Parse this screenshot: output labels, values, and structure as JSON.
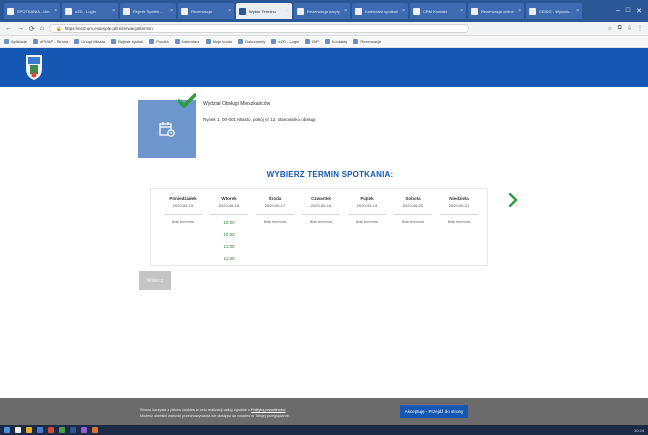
{
  "browser": {
    "tabs": [
      {
        "label": "SPOTKANIA - Um...",
        "active": false
      },
      {
        "label": "eZD - Login",
        "active": false
      },
      {
        "label": "Rejestr Spółek ...",
        "active": false
      },
      {
        "label": "Rezerwacja",
        "active": false
      },
      {
        "label": "Wybór Terminu",
        "active": true
      },
      {
        "label": "Rezerwacja wizyty",
        "active": false
      },
      {
        "label": "Kalendarz spotkań",
        "active": false
      },
      {
        "label": "CRM Kontakt",
        "active": false
      },
      {
        "label": "Rezerwacja online",
        "active": false
      },
      {
        "label": "CEIDG - Wyszuk...",
        "active": false
      }
    ],
    "url": "https://ezd.um.example.pl/rezerwacja/termin",
    "bookmarks": [
      "Aplikacje",
      "ePUAP - Strona",
      "Urząd Miasta",
      "Rejestr spółek",
      "Poczta",
      "Kalendarz",
      "Moje konto",
      "Dokumenty",
      "eZD - Login",
      "BIP",
      "Kontakty",
      "Rezerwacje"
    ]
  },
  "office": {
    "name": "Wydział Obsługi Mieszkańców",
    "address": "Rynek 1, 00-001 Miasto, pokój nr 12, stanowisko obsługi"
  },
  "heading": "WYBIERZ TERMIN SPOTKANIA:",
  "calendar": {
    "days": [
      {
        "name": "Poniedziałek",
        "date": "2020-06-15",
        "status": "Brak terminów",
        "slots": []
      },
      {
        "name": "Wtorek",
        "date": "2020-06-16",
        "status": "",
        "slots": [
          "10:00",
          "10:30",
          "11:00",
          "11:30"
        ]
      },
      {
        "name": "Środa",
        "date": "2020-06-17",
        "status": "Brak terminów",
        "slots": []
      },
      {
        "name": "Czwartek",
        "date": "2020-06-18",
        "status": "Brak terminów",
        "slots": []
      },
      {
        "name": "Piątek",
        "date": "2020-06-19",
        "status": "Brak terminów",
        "slots": []
      },
      {
        "name": "Sobota",
        "date": "2020-06-20",
        "status": "Brak terminów",
        "slots": []
      },
      {
        "name": "Niedziela",
        "date": "2020-06-21",
        "status": "Brak terminów",
        "slots": []
      }
    ]
  },
  "back_button": "Wstecz",
  "cookie": {
    "text": "Strona korzysta z plików cookies w celu realizacji usług zgodnie z",
    "link": "Polityką prywatności",
    "text2": "Możesz określić warunki przechowywania lub dostępu do cookies w Twojej przeglądarce.",
    "button": "Akceptuję - Przejdź do strony"
  },
  "taskbar": {
    "clock": "10:24"
  },
  "colors": {
    "brand": "#1458b4",
    "card": "#6d96cc",
    "check": "#2e9e3e",
    "slot": "#2b7a3a"
  }
}
